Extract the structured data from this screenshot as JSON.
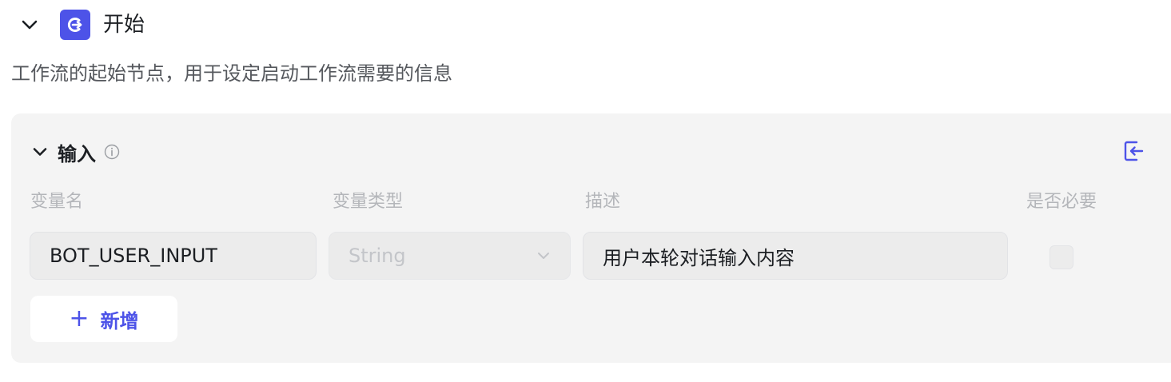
{
  "node": {
    "title": "开始",
    "description": "工作流的起始节点，用于设定启动工作流需要的信息",
    "icon": "start-node-icon",
    "accent_color": "#4d53e8"
  },
  "input_panel": {
    "title": "输入",
    "columns": {
      "name": "变量名",
      "type": "变量类型",
      "description": "描述",
      "required": "是否必要"
    },
    "rows": [
      {
        "name": "BOT_USER_INPUT",
        "type": "String",
        "description": "用户本轮对话输入内容",
        "required": false
      }
    ],
    "add_button": {
      "label": "新增",
      "icon": "plus-icon"
    }
  }
}
